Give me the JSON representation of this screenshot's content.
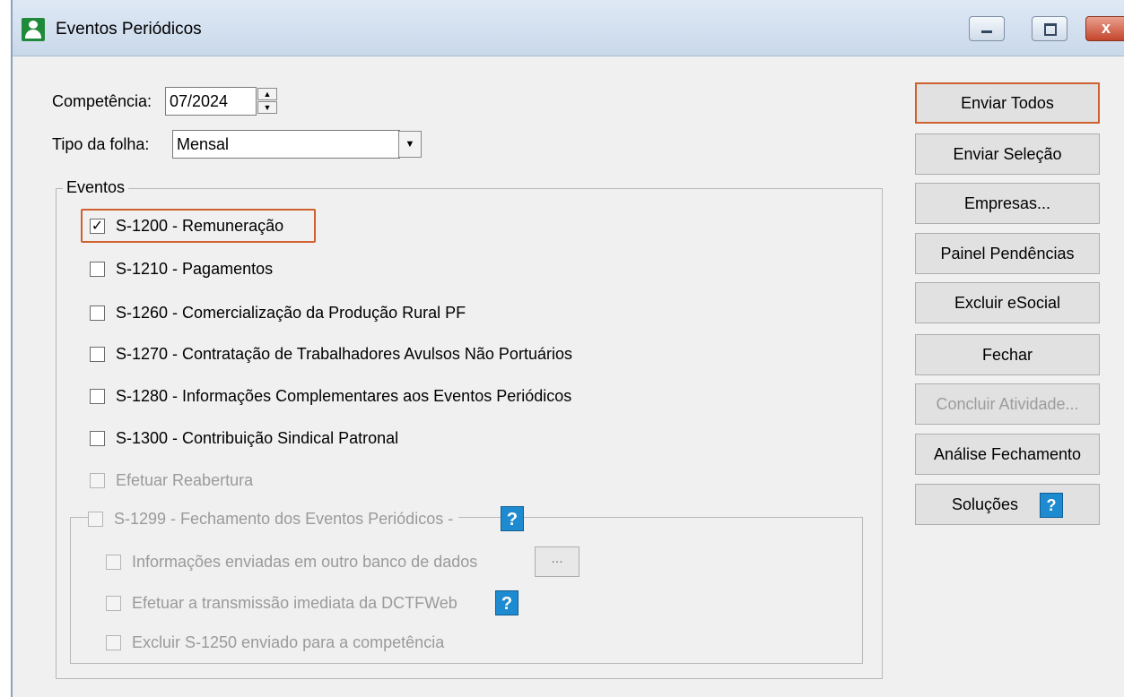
{
  "window": {
    "title": "Eventos Periódicos",
    "close_glyph": "x"
  },
  "competencia": {
    "label": "Competência:",
    "value": "07/2024"
  },
  "tipo_folha": {
    "label": "Tipo da folha:",
    "value": "Mensal"
  },
  "eventos": {
    "legend": "Eventos",
    "items": [
      {
        "label": "S-1200 - Remuneração",
        "checked": true
      },
      {
        "label": "S-1210 - Pagamentos",
        "checked": false
      },
      {
        "label": "S-1260 - Comercialização da Produção Rural PF",
        "checked": false
      },
      {
        "label": "S-1270 - Contratação de Trabalhadores Avulsos Não Portuários",
        "checked": false
      },
      {
        "label": "S-1280 - Informações Complementares aos Eventos Periódicos",
        "checked": false
      },
      {
        "label": "S-1300 - Contribuição Sindical Patronal",
        "checked": false
      }
    ],
    "reabertura": "Efetuar Reabertura",
    "fechamento": {
      "label": "S-1299 - Fechamento dos Eventos Periódicos -",
      "outro_banco": "Informações enviadas em outro banco de dados",
      "ellipsis": "...",
      "dctfweb": "Efetuar a transmissão imediata da DCTFWeb",
      "excluir_1250": "Excluir S-1250 enviado para a competência"
    },
    "help_glyph": "?"
  },
  "actions": {
    "enviar_todos": "Enviar Todos",
    "enviar_selecao": "Enviar Seleção",
    "empresas": "Empresas...",
    "painel_pendencias": "Painel Pendências",
    "excluir_esocial": "Excluir eSocial",
    "fechar": "Fechar",
    "concluir_atividade": "Concluir Atividade...",
    "analise_fechamento": "Análise Fechamento",
    "solucoes": "Soluções"
  },
  "colors": {
    "highlight": "#d0602e",
    "help": "#1e8bd0",
    "app_icon": "#1f8a3a"
  }
}
